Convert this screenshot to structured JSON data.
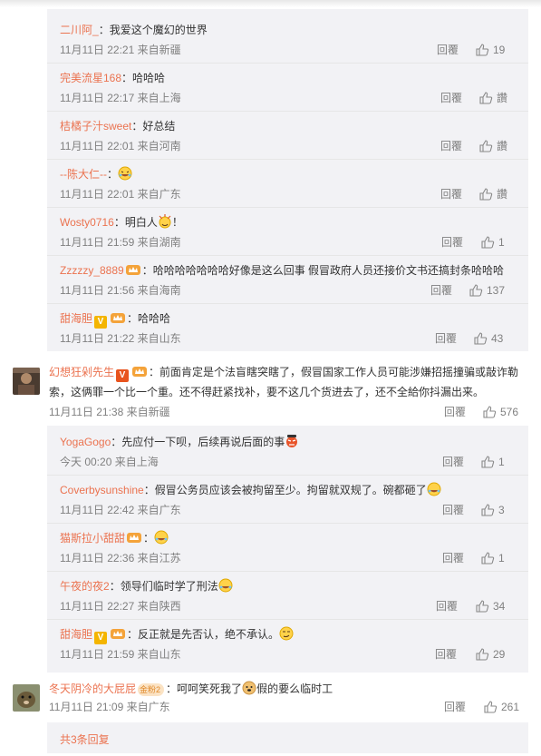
{
  "thread_a": [
    {
      "user": "二川阿_",
      "text": "我爱这个魔幻的世界",
      "time": "11月11日 22:21 来自新疆",
      "reply": "回覆",
      "likes": "19"
    },
    {
      "user": "完美流星168",
      "text": "哈哈哈",
      "time": "11月11日 22:17 来自上海",
      "reply": "回覆",
      "likes": "讚"
    },
    {
      "user": "桔橘子汁sweet",
      "text": "好总结",
      "time": "11月11日 22:01 来自河南",
      "reply": "回覆",
      "likes": "讚"
    },
    {
      "user": "--陈大仁--",
      "text": "",
      "time": "11月11日 22:01 来自广东",
      "reply": "回覆",
      "likes": "讚"
    },
    {
      "user": "Wosty0716",
      "text": "明白人",
      "text_after": "！",
      "time": "11月11日 21:59 来自湖南",
      "reply": "回覆",
      "likes": "1"
    },
    {
      "user": "Zzzzzy_8889",
      "text": "哈哈哈哈哈哈哈好像是这么回事 假冒政府人员还接价文书还搞封条哈哈哈",
      "time": "11月11日 21:56 来自海南",
      "reply": "回覆",
      "likes": "137"
    },
    {
      "user": "甜海胆",
      "text": "哈哈哈",
      "time": "11月11日 21:22 来自山东",
      "reply": "回覆",
      "likes": "43"
    }
  ],
  "main_comment": {
    "user": "幻想狂剁先生",
    "text": "前面肯定是个法盲瞎突瞎了，假冒国家工作人员可能涉嫌招摇撞骗或敲诈勒索，这俩罪一个比一个重。还不得赶紧找补，要不这几个货进去了，还不全給你抖漏出来。",
    "time": "11月11日 21:38 来自新疆",
    "reply": "回覆",
    "likes": "576"
  },
  "thread_b": [
    {
      "user": "YogaGogo",
      "text": "先应付一下呗，后续再说后面的事",
      "time": "今天 00:20 来自上海",
      "reply": "回覆",
      "likes": "1"
    },
    {
      "user": "Coverbysunshine",
      "text": "假冒公务员应该会被拘留至少。拘留就双规了。碗都砸了",
      "time": "11月11日 22:42 来自广东",
      "reply": "回覆",
      "likes": "3"
    },
    {
      "user": "猫斯拉小甜甜",
      "text": "",
      "time": "11月11日 22:36 来自江苏",
      "reply": "回覆",
      "likes": "1"
    },
    {
      "user": "午夜的夜2",
      "text": "领导们临时学了刑法",
      "time": "11月11日 22:27 来自陕西",
      "reply": "回覆",
      "likes": "34"
    },
    {
      "user": "甜海胆",
      "text": "反正就是先否认，绝不承认。",
      "time": "11月11日 21:59 来自山东",
      "reply": "回覆",
      "likes": "29"
    }
  ],
  "bottom_comment": {
    "user": "冬天阴冷的大屁屁",
    "fan_badge": "金粉2",
    "text": "呵呵笑死我了",
    "text_after": "假的要么临时工",
    "time": "11月11日 21:09 来自广东",
    "reply": "回覆",
    "likes": "261"
  },
  "more_replies": "共3条回复",
  "colors": {
    "username": "#eb7350",
    "meta": "#808080",
    "reply_bg": "#f2f2f5",
    "vip": "#f4b500"
  },
  "icons": [
    "thumb-up-icon",
    "vip-v-icon",
    "crown-icon",
    "laugh-emoji",
    "clap-emoji",
    "avatar"
  ]
}
